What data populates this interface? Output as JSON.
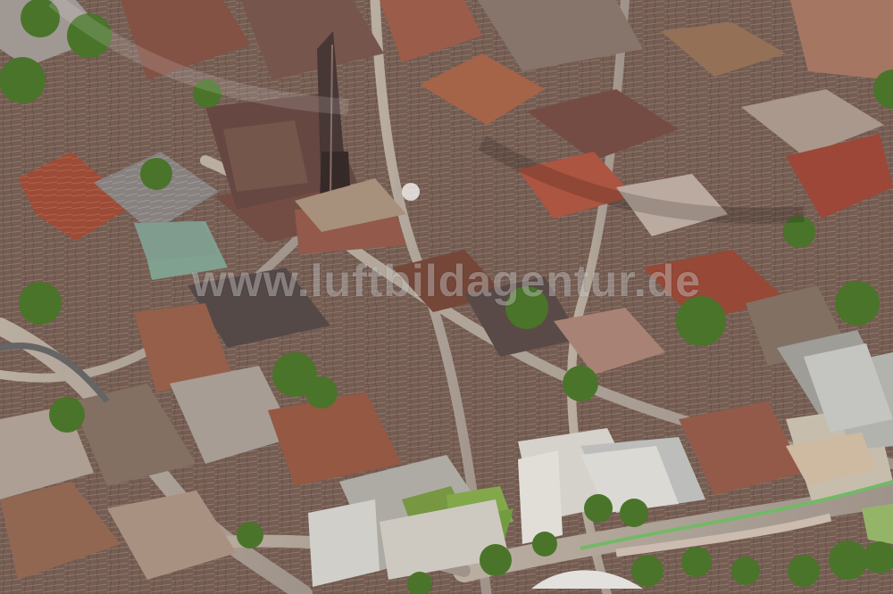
{
  "image": {
    "watermark_text": "www.luftbildagentur.de"
  },
  "palette": {
    "roof_red": "#a54d38",
    "roof_dark": "#4d4645",
    "roof_light": "#b9aaa1",
    "roof_brown": "#7a5143",
    "street": "#b7aa9f",
    "tree": "#4d7a2e",
    "green_roof": "#7ea047",
    "water_blue": "#7fa8b0"
  }
}
